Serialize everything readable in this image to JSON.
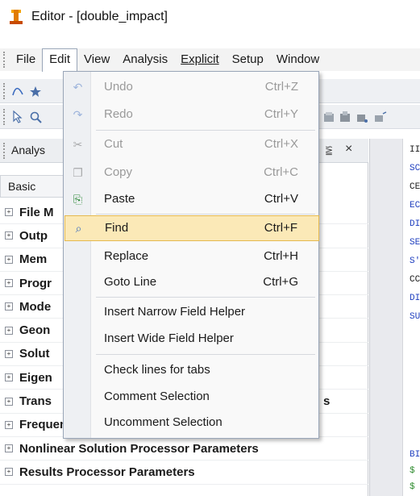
{
  "window": {
    "title": "Editor - [double_impact]"
  },
  "menubar": {
    "items": [
      "File",
      "Edit",
      "View",
      "Analysis",
      "Explicit",
      "Setup",
      "Window"
    ]
  },
  "panel": {
    "title": "Analys",
    "pin": "⪠",
    "close": "×",
    "tab": "Basic"
  },
  "tree": {
    "expander": "+",
    "items": [
      "File M",
      "Outp",
      "Mem",
      "Progr",
      "Mode",
      "Geon",
      "Solut",
      "Eigen",
      "Trans",
      "Frequency Response Processor Parameters",
      "Nonlinear Solution Processor Parameters",
      "Results Processor Parameters"
    ],
    "trans_suffix": "s"
  },
  "edit_menu": {
    "items": [
      {
        "label": "Undo",
        "shortcut": "Ctrl+Z",
        "icon": "undo-icon",
        "glyph": "↶",
        "disabled": true
      },
      {
        "label": "Redo",
        "shortcut": "Ctrl+Y",
        "icon": "redo-icon",
        "glyph": "↷",
        "disabled": true
      },
      {
        "label": "Cut",
        "shortcut": "Ctrl+X",
        "icon": "scissors-icon",
        "glyph": "✂",
        "disabled": true
      },
      {
        "label": "Copy",
        "shortcut": "Ctrl+C",
        "icon": "copy-icon",
        "glyph": "❐",
        "disabled": true
      },
      {
        "label": "Paste",
        "shortcut": "Ctrl+V",
        "icon": "paste-icon",
        "glyph": "⎘",
        "disabled": false
      },
      {
        "label": "Find",
        "shortcut": "Ctrl+F",
        "icon": "magnifier-icon",
        "glyph": "⌕",
        "disabled": false,
        "highlighted": true
      },
      {
        "label": "Replace",
        "shortcut": "Ctrl+H",
        "disabled": false
      },
      {
        "label": "Goto Line",
        "shortcut": "Ctrl+G",
        "disabled": false
      },
      {
        "label": "Insert Narrow Field Helper",
        "shortcut": "",
        "disabled": false
      },
      {
        "label": "Insert Wide Field Helper",
        "shortcut": "",
        "disabled": false
      },
      {
        "label": "Check lines for tabs",
        "shortcut": "",
        "disabled": false
      },
      {
        "label": "Comment Selection",
        "shortcut": "",
        "disabled": false
      },
      {
        "label": "Uncomment Selection",
        "shortcut": "",
        "disabled": false
      }
    ]
  },
  "code_preview": {
    "lines": [
      {
        "text": "II",
        "color": "#1a1a1a"
      },
      {
        "text": "SC",
        "color": "#1f3fbf"
      },
      {
        "text": "CE",
        "color": "#1a1a1a"
      },
      {
        "text": "EC",
        "color": "#1f3fbf"
      },
      {
        "text": "DI",
        "color": "#1f3fbf"
      },
      {
        "text": "SE",
        "color": "#1f3fbf"
      },
      {
        "text": "S'",
        "color": "#1f3fbf"
      },
      {
        "text": "CC",
        "color": "#1a1a1a"
      },
      {
        "text": "DI",
        "color": "#1f3fbf"
      },
      {
        "text": "SU",
        "color": "#1f3fbf"
      },
      {
        "text": "BI",
        "color": "#1f3fbf"
      },
      {
        "text": "$",
        "color": "#2e8b2e"
      },
      {
        "text": "$",
        "color": "#2e8b2e"
      }
    ]
  },
  "colors": {
    "highlight_bg": "#fbe9b7",
    "highlight_border": "#e5b94e",
    "keyword_blue": "#1f3fbf",
    "comment_green": "#2e8b2e"
  }
}
